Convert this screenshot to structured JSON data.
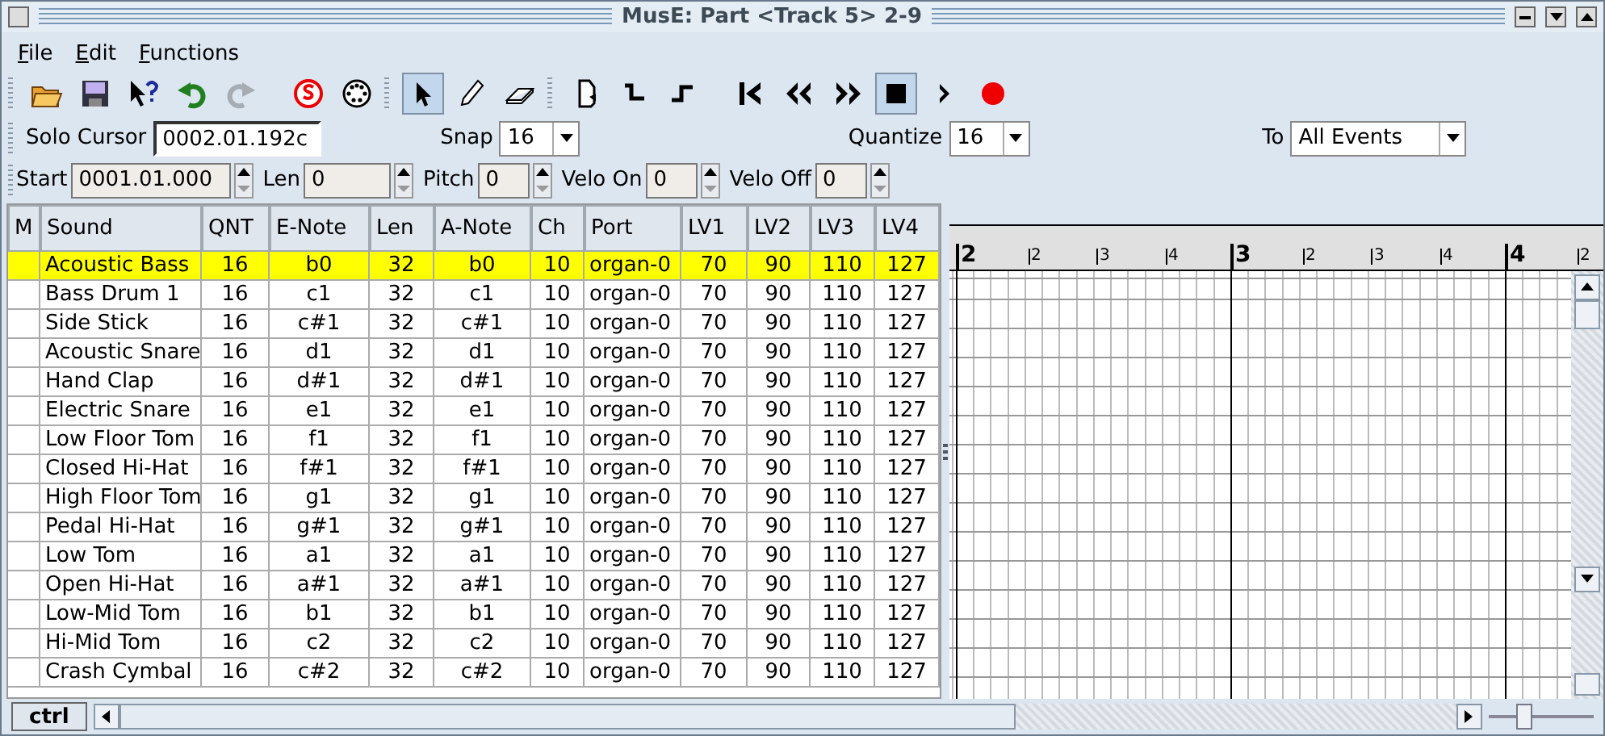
{
  "window": {
    "title": "MusE: Part <Track 5> 2-9"
  },
  "menu": [
    "File",
    "Edit",
    "Functions"
  ],
  "toolbar": [
    {
      "kind": "open",
      "selected": false,
      "disabled": false
    },
    {
      "kind": "save",
      "selected": false,
      "disabled": false
    },
    {
      "kind": "whatsthis",
      "selected": false,
      "disabled": false
    },
    {
      "kind": "undo",
      "selected": false,
      "disabled": false
    },
    {
      "kind": "redo",
      "selected": false,
      "disabled": true
    },
    {
      "kind": "solo",
      "selected": false,
      "disabled": false
    },
    {
      "kind": "midi",
      "selected": false,
      "disabled": false
    },
    {
      "kind": "pointer",
      "selected": true,
      "disabled": false
    },
    {
      "kind": "pencil",
      "selected": false,
      "disabled": false
    },
    {
      "kind": "eraser",
      "selected": false,
      "disabled": false
    },
    {
      "kind": "loop",
      "selected": false,
      "disabled": false
    },
    {
      "kind": "stepdown",
      "selected": false,
      "disabled": false
    },
    {
      "kind": "stepup",
      "selected": false,
      "disabled": false
    },
    {
      "kind": "tostart",
      "selected": false,
      "disabled": false
    },
    {
      "kind": "rewind",
      "selected": false,
      "disabled": false
    },
    {
      "kind": "forward",
      "selected": false,
      "disabled": false
    },
    {
      "kind": "stop",
      "selected": true,
      "disabled": false
    },
    {
      "kind": "play",
      "selected": false,
      "disabled": false
    },
    {
      "kind": "record",
      "selected": false,
      "disabled": false
    }
  ],
  "solo_cursor": {
    "label": "Solo Cursor",
    "value": "0002.01.192c"
  },
  "snap": {
    "label": "Snap",
    "value": "16"
  },
  "quantize": {
    "label": "Quantize",
    "value": "16"
  },
  "to": {
    "label": "To",
    "value": "All Events"
  },
  "event_fields": [
    {
      "label": "Start",
      "value": "0001.01.000"
    },
    {
      "label": "Len",
      "value": "0"
    },
    {
      "label": "Pitch",
      "value": "0"
    },
    {
      "label": "Velo On",
      "value": "0"
    },
    {
      "label": "Velo Off",
      "value": "0"
    }
  ],
  "table": {
    "columns": [
      "M",
      "Sound",
      "QNT",
      "E-Note",
      "Len",
      "A-Note",
      "Ch",
      "Port",
      "LV1",
      "LV2",
      "LV3",
      "LV4"
    ],
    "rows": [
      {
        "selected": true,
        "cells": [
          "",
          "Acoustic Bass",
          "16",
          "b0",
          "32",
          "b0",
          "10",
          "organ-0",
          "70",
          "90",
          "110",
          "127"
        ]
      },
      {
        "selected": false,
        "cells": [
          "",
          "Bass Drum 1",
          "16",
          "c1",
          "32",
          "c1",
          "10",
          "organ-0",
          "70",
          "90",
          "110",
          "127"
        ]
      },
      {
        "selected": false,
        "cells": [
          "",
          "Side Stick",
          "16",
          "c#1",
          "32",
          "c#1",
          "10",
          "organ-0",
          "70",
          "90",
          "110",
          "127"
        ]
      },
      {
        "selected": false,
        "cells": [
          "",
          "Acoustic Snare",
          "16",
          "d1",
          "32",
          "d1",
          "10",
          "organ-0",
          "70",
          "90",
          "110",
          "127"
        ]
      },
      {
        "selected": false,
        "cells": [
          "",
          "Hand Clap",
          "16",
          "d#1",
          "32",
          "d#1",
          "10",
          "organ-0",
          "70",
          "90",
          "110",
          "127"
        ]
      },
      {
        "selected": false,
        "cells": [
          "",
          "Electric Snare",
          "16",
          "e1",
          "32",
          "e1",
          "10",
          "organ-0",
          "70",
          "90",
          "110",
          "127"
        ]
      },
      {
        "selected": false,
        "cells": [
          "",
          "Low Floor Tom",
          "16",
          "f1",
          "32",
          "f1",
          "10",
          "organ-0",
          "70",
          "90",
          "110",
          "127"
        ]
      },
      {
        "selected": false,
        "cells": [
          "",
          "Closed Hi-Hat",
          "16",
          "f#1",
          "32",
          "f#1",
          "10",
          "organ-0",
          "70",
          "90",
          "110",
          "127"
        ]
      },
      {
        "selected": false,
        "cells": [
          "",
          "High Floor Tom",
          "16",
          "g1",
          "32",
          "g1",
          "10",
          "organ-0",
          "70",
          "90",
          "110",
          "127"
        ]
      },
      {
        "selected": false,
        "cells": [
          "",
          "Pedal Hi-Hat",
          "16",
          "g#1",
          "32",
          "g#1",
          "10",
          "organ-0",
          "70",
          "90",
          "110",
          "127"
        ]
      },
      {
        "selected": false,
        "cells": [
          "",
          "Low Tom",
          "16",
          "a1",
          "32",
          "a1",
          "10",
          "organ-0",
          "70",
          "90",
          "110",
          "127"
        ]
      },
      {
        "selected": false,
        "cells": [
          "",
          "Open Hi-Hat",
          "16",
          "a#1",
          "32",
          "a#1",
          "10",
          "organ-0",
          "70",
          "90",
          "110",
          "127"
        ]
      },
      {
        "selected": false,
        "cells": [
          "",
          "Low-Mid Tom",
          "16",
          "b1",
          "32",
          "b1",
          "10",
          "organ-0",
          "70",
          "90",
          "110",
          "127"
        ]
      },
      {
        "selected": false,
        "cells": [
          "",
          "Hi-Mid Tom",
          "16",
          "c2",
          "32",
          "c2",
          "10",
          "organ-0",
          "70",
          "90",
          "110",
          "127"
        ]
      },
      {
        "selected": false,
        "cells": [
          "",
          "Crash Cymbal",
          "16",
          "c#2",
          "32",
          "c#2",
          "10",
          "organ-0",
          "70",
          "90",
          "110",
          "127"
        ]
      }
    ]
  },
  "ruler": {
    "bars": [
      {
        "label": "2",
        "beats": [
          "2",
          "3",
          "4"
        ]
      },
      {
        "label": "3",
        "beats": [
          "2",
          "3",
          "4"
        ]
      },
      {
        "label": "4",
        "beats": [
          "2"
        ]
      }
    ]
  },
  "ctrl_button": "ctrl",
  "zoom": {
    "level": 0.3
  }
}
